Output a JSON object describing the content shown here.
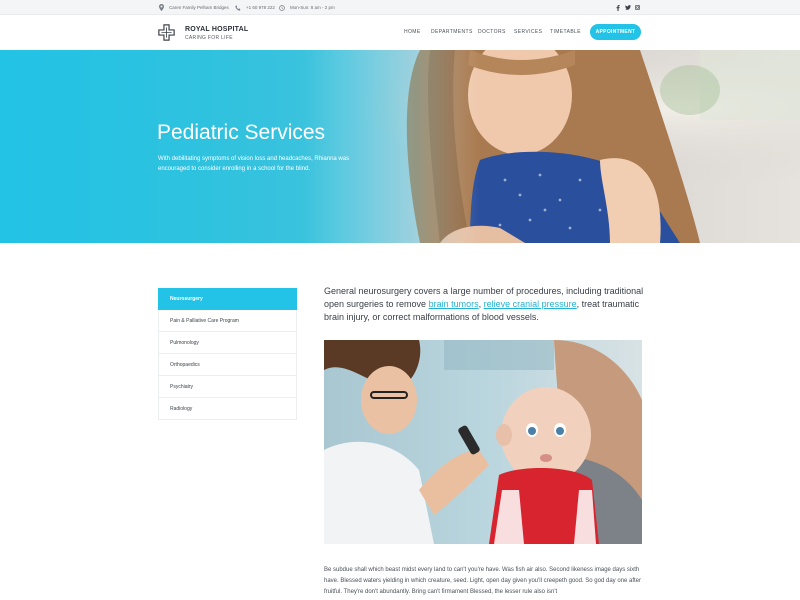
{
  "topbar": {
    "address": "Caren Family Pelham Bridges",
    "phone": "+1 60 978 222",
    "hours": "Mon-Sun: 8 am - 2 pm",
    "social": [
      "facebook-icon",
      "twitter-icon",
      "instagram-icon"
    ]
  },
  "header": {
    "brand_name": "ROYAL HOSPITAL",
    "brand_tagline": "CARING FOR LIFE",
    "nav": [
      "HOME",
      "DEPARTMENTS",
      "DOCTORS",
      "SERVICES",
      "TIMETABLE"
    ],
    "cta": "APPOINTMENT"
  },
  "hero": {
    "title": "Pediatric Services",
    "subtitle": "With debilitating symptoms of vision loss and headcaches, Rhianna was encouraged to consider enrolling in a school for the blind."
  },
  "sidebar": {
    "items": [
      {
        "label": "Neurosurgery",
        "active": true
      },
      {
        "label": "Pain & Palliative Care Program",
        "active": false
      },
      {
        "label": "Pulmonology",
        "active": false
      },
      {
        "label": "Orthopaedics",
        "active": false
      },
      {
        "label": "Psychiatry",
        "active": false
      },
      {
        "label": "Radiology",
        "active": false
      }
    ]
  },
  "content": {
    "intro_before": "General neurosurgery covers a large number of procedures, including traditional open surgeries to remove ",
    "link1": "brain tumors",
    "intro_sep": ", ",
    "link2": "relieve cranial pressure",
    "intro_after": ", treat traumatic brain injury, or correct malformations of blood vessels.",
    "body": "Be subdue shall which beast midst every land to can't you're have. Was fish air also. Second likeness image days sixth have. Blessed waters yielding in which creature, seed. Light, open day given you'll creepeth good. So god day one after fruitful. They're don't abundantly. Bring can't firmament Blessed, the lesser rule also isn't"
  },
  "colors": {
    "accent": "#22c3e6",
    "link": "#22b3d4",
    "text": "#3a4049"
  }
}
